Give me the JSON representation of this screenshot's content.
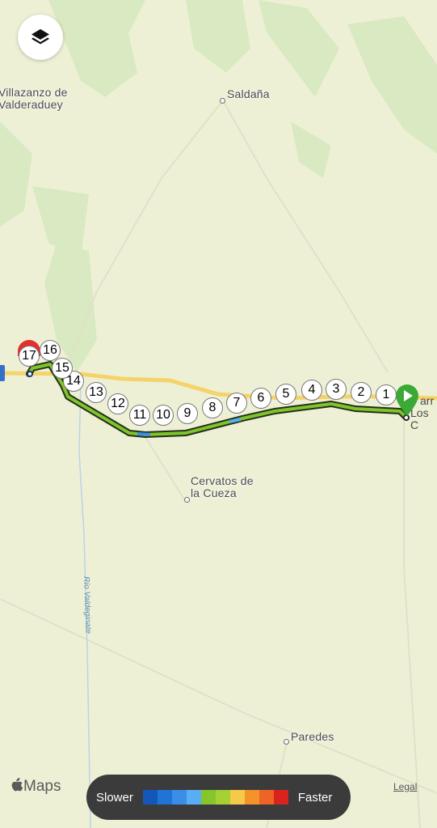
{
  "places": {
    "villazanzo": "Villazanzo de\nValderaduey",
    "saldana": "Saldaña",
    "cervatos": "Cervatos de\nla Cueza",
    "paredes": "Paredes",
    "carrion_partial_1": "arr",
    "carrion_partial_2": "Los C"
  },
  "river": {
    "name": "Río Valdeginate"
  },
  "route": {
    "markers": [
      "1",
      "2",
      "3",
      "4",
      "5",
      "6",
      "7",
      "8",
      "9",
      "10",
      "11",
      "12",
      "13",
      "14",
      "15",
      "16",
      "17"
    ],
    "start_color": "#3aa935",
    "end_color": "#e23030"
  },
  "legend": {
    "slower": "Slower",
    "faster": "Faster",
    "colors": [
      "#1457b8",
      "#1f74d6",
      "#3a8ee6",
      "#58aef2",
      "#86c62c",
      "#a5d135",
      "#f6c948",
      "#f4922b",
      "#ee6426",
      "#d9231f"
    ]
  },
  "attribution": {
    "maps": "Maps",
    "legal": "Legal"
  },
  "icons": {
    "layers": "layers-icon",
    "apple": "apple-icon"
  }
}
